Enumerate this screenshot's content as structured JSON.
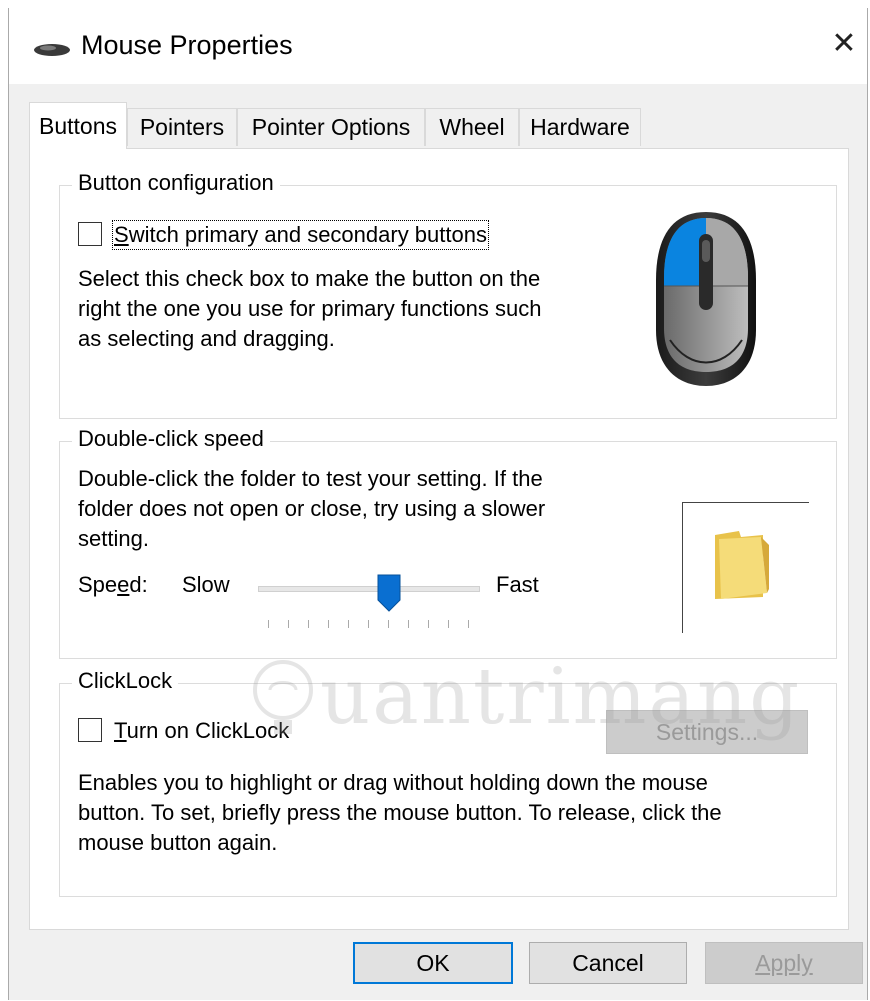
{
  "window": {
    "title": "Mouse Properties",
    "close_glyph": "✕",
    "app_icon": "mouse-icon"
  },
  "tabs": [
    {
      "label": "Buttons",
      "active": true
    },
    {
      "label": "Pointers",
      "active": false
    },
    {
      "label": "Pointer Options",
      "active": false
    },
    {
      "label": "Wheel",
      "active": false
    },
    {
      "label": "Hardware",
      "active": false
    }
  ],
  "button_config": {
    "group_label": "Button configuration",
    "checkbox_label": "Switch primary and secondary buttons",
    "checked": false,
    "description_lines": [
      "Select this check box to make the button on the",
      "right the one you use for primary functions such",
      "as selecting and dragging."
    ],
    "image": "mouse-illustration-icon",
    "highlight_color": "#0a84e0"
  },
  "double_click": {
    "group_label": "Double-click speed",
    "description_lines": [
      "Double-click the folder to test your setting. If the",
      "folder does not open or close, try using a slower",
      "setting."
    ],
    "speed_label_pre": "Spe",
    "speed_label_u": "e",
    "speed_label_post": "d:",
    "slow_label": "Slow",
    "fast_label": "Fast",
    "slider_value_fraction": 0.6,
    "test_icon": "folder-icon"
  },
  "clicklock": {
    "group_label": "ClickLock",
    "checkbox_label_u": "T",
    "checkbox_label_rest": "urn on ClickLock",
    "checked": false,
    "settings_button": "Settings...",
    "description_lines": [
      "Enables you to highlight or drag without holding down the mouse",
      "button. To set, briefly press the mouse button. To release, click the",
      "mouse button again."
    ]
  },
  "footer": {
    "ok": "OK",
    "cancel": "Cancel",
    "apply": "Apply"
  },
  "watermark": {
    "text": "uantrimang",
    "icon": "lightbulb-logo-icon"
  },
  "colors": {
    "accent": "#0078d7",
    "slider_thumb": "#0a6fd1",
    "folder": "#f2d469"
  }
}
